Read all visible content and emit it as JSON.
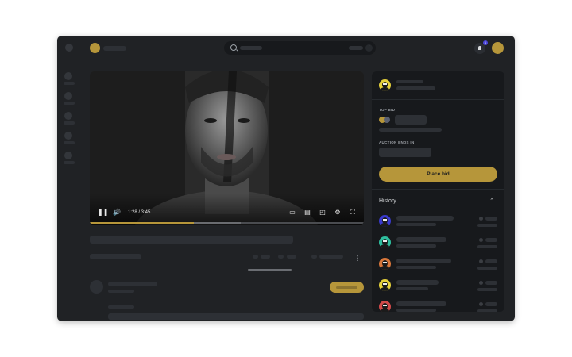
{
  "player": {
    "time": "1:28 / 3:45",
    "progress": 0.38,
    "buffered": 0.55,
    "icons": [
      "pause-icon",
      "volume-icon",
      "cast-icon",
      "subtitles-icon",
      "miniplayer-icon",
      "settings-icon",
      "fullscreen-icon"
    ]
  },
  "panel": {
    "top_bid_label": "TOP BID",
    "auction_label": "AUCTION ENDS IN",
    "place_bid_label": "Place bid",
    "history_title": "History",
    "history_avatar_colors": [
      "#3a3ad0",
      "#2ebf9f",
      "#d9773a",
      "#e6d13a",
      "#d24a4a"
    ]
  },
  "colors": {
    "accent": "#b6963a",
    "background": "#202225",
    "panel": "#17191c",
    "notification": "#4b45d9"
  },
  "search": {
    "kbd": "/"
  },
  "notifications": {
    "badge": "1"
  }
}
